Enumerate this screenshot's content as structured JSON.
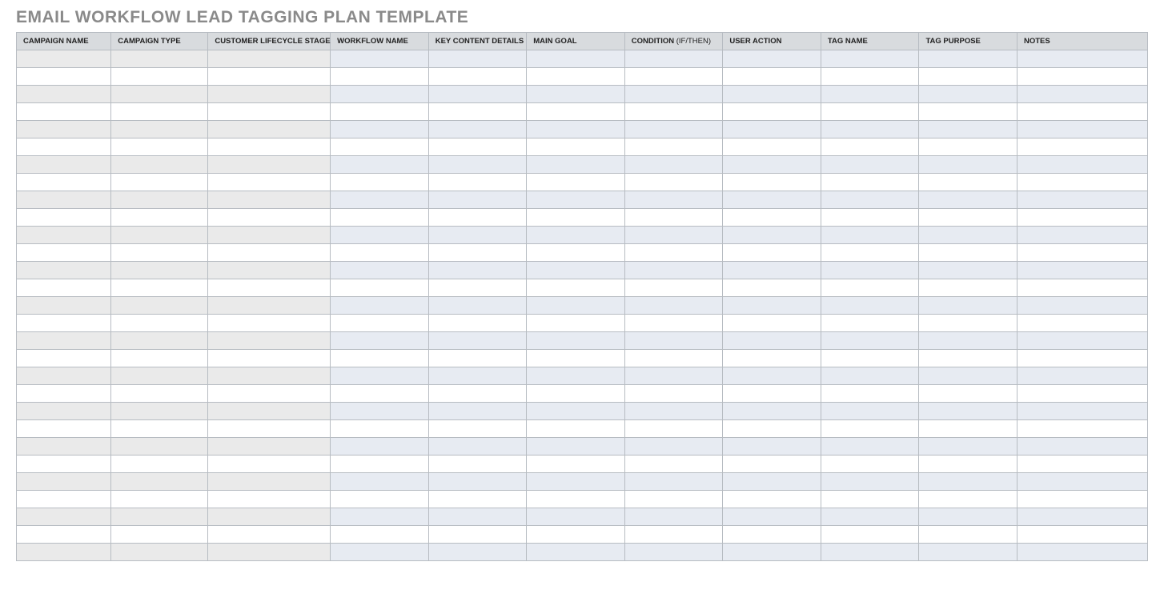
{
  "title": "EMAIL WORKFLOW LEAD TAGGING PLAN TEMPLATE",
  "columns": [
    {
      "label": "CAMPAIGN NAME",
      "light": "",
      "group": "a"
    },
    {
      "label": "CAMPAIGN TYPE",
      "light": "",
      "group": "a"
    },
    {
      "label": "CUSTOMER LIFECYCLE STAGE",
      "light": "",
      "group": "a"
    },
    {
      "label": "WORKFLOW NAME",
      "light": "",
      "group": "b"
    },
    {
      "label": "KEY CONTENT DETAILS",
      "light": "",
      "group": "b"
    },
    {
      "label": "MAIN GOAL",
      "light": "",
      "group": "b"
    },
    {
      "label": "CONDITION",
      "light": " (IF/THEN)",
      "group": "b"
    },
    {
      "label": "USER ACTION",
      "light": "",
      "group": "b"
    },
    {
      "label": "TAG NAME",
      "light": "",
      "group": "b"
    },
    {
      "label": "TAG PURPOSE",
      "light": "",
      "group": "b"
    },
    {
      "label": "NOTES",
      "light": "",
      "group": "b"
    }
  ],
  "row_count": 29
}
